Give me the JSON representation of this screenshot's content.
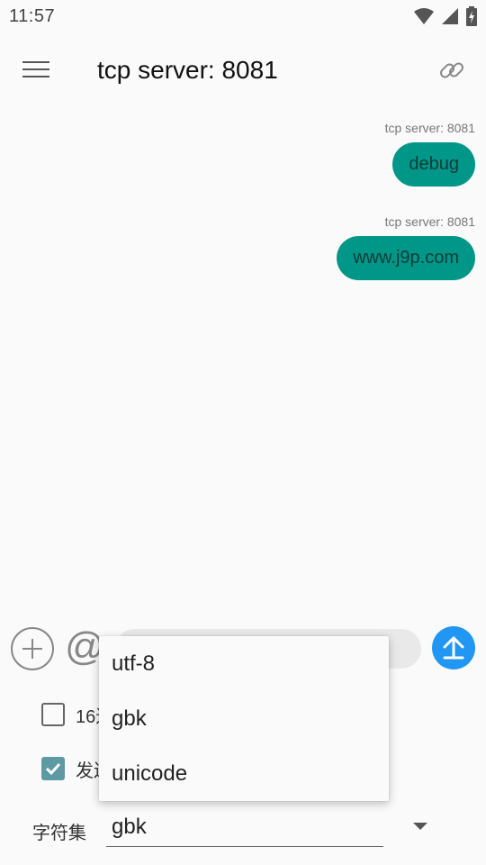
{
  "status_bar": {
    "time": "11:57"
  },
  "app_bar": {
    "title": "tcp server: 8081"
  },
  "messages": [
    {
      "sender": "tcp server: 8081",
      "text": "debug"
    },
    {
      "sender": "tcp server: 8081",
      "text": "www.j9p.com"
    }
  ],
  "input": {
    "at_symbol": "@",
    "placeholder": ""
  },
  "options": {
    "hex_label": "16进",
    "hex_checked": false,
    "send_label": "发送",
    "send_checked": true
  },
  "charset": {
    "label": "字符集",
    "value": "gbk"
  },
  "dropdown": {
    "items": [
      "utf-8",
      "gbk",
      "unicode"
    ]
  },
  "colors": {
    "bubble": "#009688",
    "send_button": "#2196f3",
    "checkbox_checked": "#5d9aa3"
  }
}
